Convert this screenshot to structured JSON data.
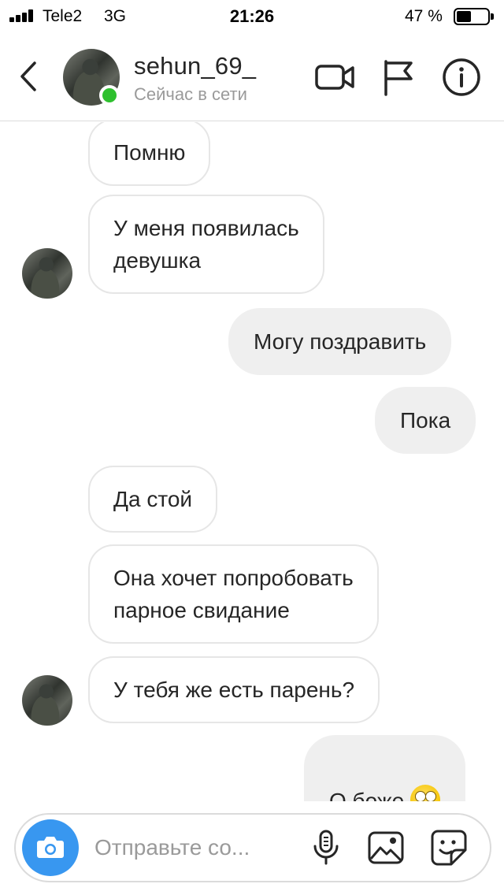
{
  "status_bar": {
    "carrier": "Tele2",
    "network": "3G",
    "time": "21:26",
    "battery_percent": "47 %",
    "battery_level": 0.47
  },
  "header": {
    "username": "sehun_69_",
    "status": "Сейчас в сети",
    "online": true,
    "icons": [
      "back-icon",
      "video-camera-icon",
      "flag-icon",
      "info-icon"
    ]
  },
  "messages": [
    {
      "direction": "in",
      "text": "Помню"
    },
    {
      "direction": "in",
      "text": "У меня появилась\nдевушка"
    },
    {
      "direction": "out",
      "text": "Могу поздравить"
    },
    {
      "direction": "out",
      "text": "Пока"
    },
    {
      "direction": "in",
      "text": "Да стой"
    },
    {
      "direction": "in",
      "text": "Она хочет попробовать\nпарное свидание"
    },
    {
      "direction": "in",
      "text": "У тебя же есть парень?"
    },
    {
      "direction": "out",
      "text": "О боже",
      "emoji": "face-with-rolling-eyes"
    }
  ],
  "composer": {
    "placeholder": "Отправьте со..."
  },
  "colors": {
    "online": "#2ec02e",
    "camera_button": "#3897f0",
    "outgoing_bubble": "#efefef",
    "incoming_border": "#e6e6e6"
  }
}
